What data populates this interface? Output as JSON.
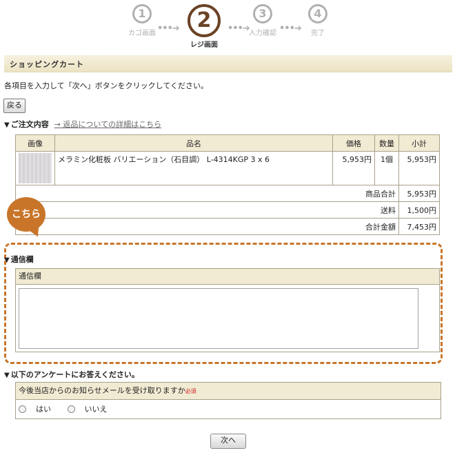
{
  "steps": [
    {
      "num": "①",
      "label": "カゴ画面"
    },
    {
      "num": "②",
      "label": "レジ画面"
    },
    {
      "num": "③",
      "label": "入力確認"
    },
    {
      "num": "④",
      "label": "完了"
    }
  ],
  "step_arrow": "•••➔",
  "page_title": "ショッピングカート",
  "instruction": "各項目を入力して「次へ」ボタンをクリックしてください。",
  "back_button": "戻る",
  "order": {
    "heading": "ご注文内容",
    "return_link": "→ 返品についての詳細はこちら",
    "columns": [
      "画像",
      "品名",
      "価格",
      "数量",
      "小計"
    ],
    "item": {
      "name": "メラミン化粧板 バリエーション（石目調） L-4314KGP 3 x 6",
      "price": "5,953円",
      "qty": "1個",
      "subtotal": "5,953円"
    },
    "summary": [
      {
        "label": "商品合計",
        "value": "5,953円"
      },
      {
        "label": "送料",
        "value": "1,500円"
      },
      {
        "label": "合計金額",
        "value": "7,453円"
      }
    ]
  },
  "callout": "こちら",
  "message": {
    "heading": "通信欄",
    "field_label": "通信欄",
    "value": ""
  },
  "survey": {
    "heading": "以下のアンケートにお答えください。",
    "question": "今後当店からのお知らせメールを受け取りますか",
    "required": "必須",
    "options": [
      "はい",
      "いいえ"
    ]
  },
  "next_button": "次へ",
  "colors": {
    "accent": "#c8752a",
    "active_step": "#6b4226",
    "header_bg": "#f1ebd3"
  }
}
